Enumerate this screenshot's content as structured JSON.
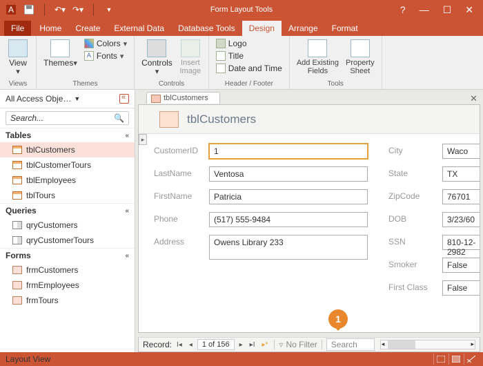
{
  "titlebar": {
    "contextual": "Form Layout Tools"
  },
  "tabs": {
    "file": "File",
    "home": "Home",
    "create": "Create",
    "external": "External Data",
    "db": "Database Tools",
    "design": "Design",
    "arrange": "Arrange",
    "format": "Format"
  },
  "ribbon": {
    "views": {
      "view": "View",
      "label": "Views"
    },
    "themes": {
      "themes": "Themes",
      "colors": "Colors",
      "fonts": "Fonts",
      "label": "Themes"
    },
    "controls": {
      "controls": "Controls",
      "insert_image": "Insert\nImage",
      "label": "Controls"
    },
    "header": {
      "logo": "Logo",
      "title": "Title",
      "datetime": "Date and Time",
      "label": "Header / Footer"
    },
    "tools": {
      "add_fields": "Add Existing\nFields",
      "prop": "Property\nSheet",
      "label": "Tools"
    }
  },
  "nav": {
    "title": "All Access Obje…",
    "search_ph": "Search...",
    "tables": {
      "label": "Tables",
      "items": [
        "tblCustomers",
        "tblCustomerTours",
        "tblEmployees",
        "tblTours"
      ]
    },
    "queries": {
      "label": "Queries",
      "items": [
        "qryCustomers",
        "qryCustomerTours"
      ]
    },
    "forms": {
      "label": "Forms",
      "items": [
        "frmCustomers",
        "frmEmployees",
        "frmTours"
      ]
    }
  },
  "form": {
    "tab": "tblCustomers",
    "title": "tblCustomers",
    "left_labels": [
      "CustomerID",
      "LastName",
      "FirstName",
      "Phone",
      "Address"
    ],
    "left_values": [
      "1",
      "Ventosa",
      "Patricia",
      "(517) 555-9484",
      "Owens Library 233"
    ],
    "right_labels": [
      "City",
      "State",
      "ZipCode",
      "DOB",
      "SSN",
      "Smoker",
      "First Class"
    ],
    "right_values": [
      "Waco",
      "TX",
      "76701",
      "3/23/60",
      "810-12-2982",
      "False",
      "False"
    ]
  },
  "recnav": {
    "label": "Record:",
    "pos": "1 of 156",
    "nofilter": "No Filter",
    "search": "Search"
  },
  "status": {
    "mode": "Layout View"
  },
  "callout": "1"
}
